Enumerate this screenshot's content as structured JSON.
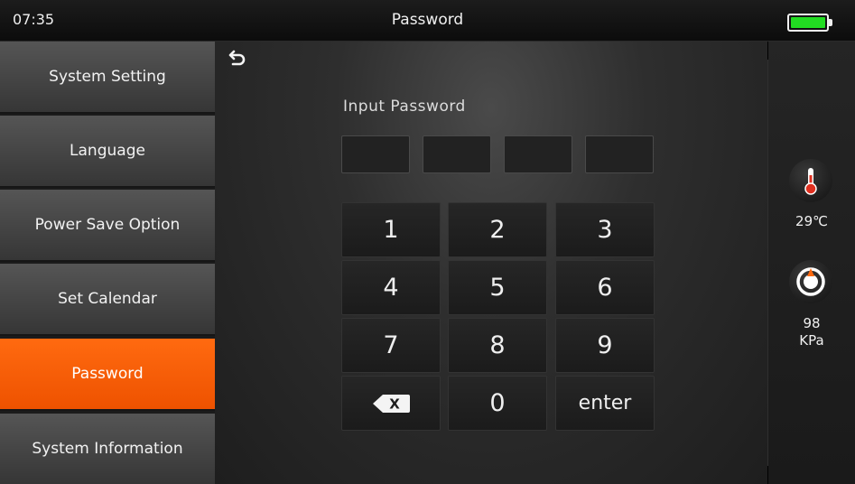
{
  "statusbar": {
    "time": "07:35",
    "title": "Password",
    "battery_icon": "battery-full-icon",
    "battery_color": "#22dd22"
  },
  "sidebar": {
    "items": [
      {
        "label": "System Setting",
        "active": false
      },
      {
        "label": "Language",
        "active": false
      },
      {
        "label": "Power Save Option",
        "active": false
      },
      {
        "label": "Set Calendar",
        "active": false
      },
      {
        "label": "Password",
        "active": true
      },
      {
        "label": "System Information",
        "active": false
      }
    ],
    "active_color": "#ff5f00"
  },
  "main": {
    "back_icon": "back-arrow-icon",
    "input_label": "Input Password",
    "pin_boxes": [
      "",
      "",
      "",
      ""
    ],
    "keypad": {
      "keys": [
        "1",
        "2",
        "3",
        "4",
        "5",
        "6",
        "7",
        "8",
        "9",
        "backspace",
        "0",
        "enter"
      ],
      "backspace_glyph": "X",
      "backspace_icon": "backspace-icon",
      "enter_label": "enter"
    }
  },
  "sensors": {
    "temperature": {
      "icon": "thermometer-icon",
      "value": "29℃"
    },
    "pressure": {
      "icon": "pressure-gauge-icon",
      "value": "98",
      "unit": "KPa"
    }
  }
}
